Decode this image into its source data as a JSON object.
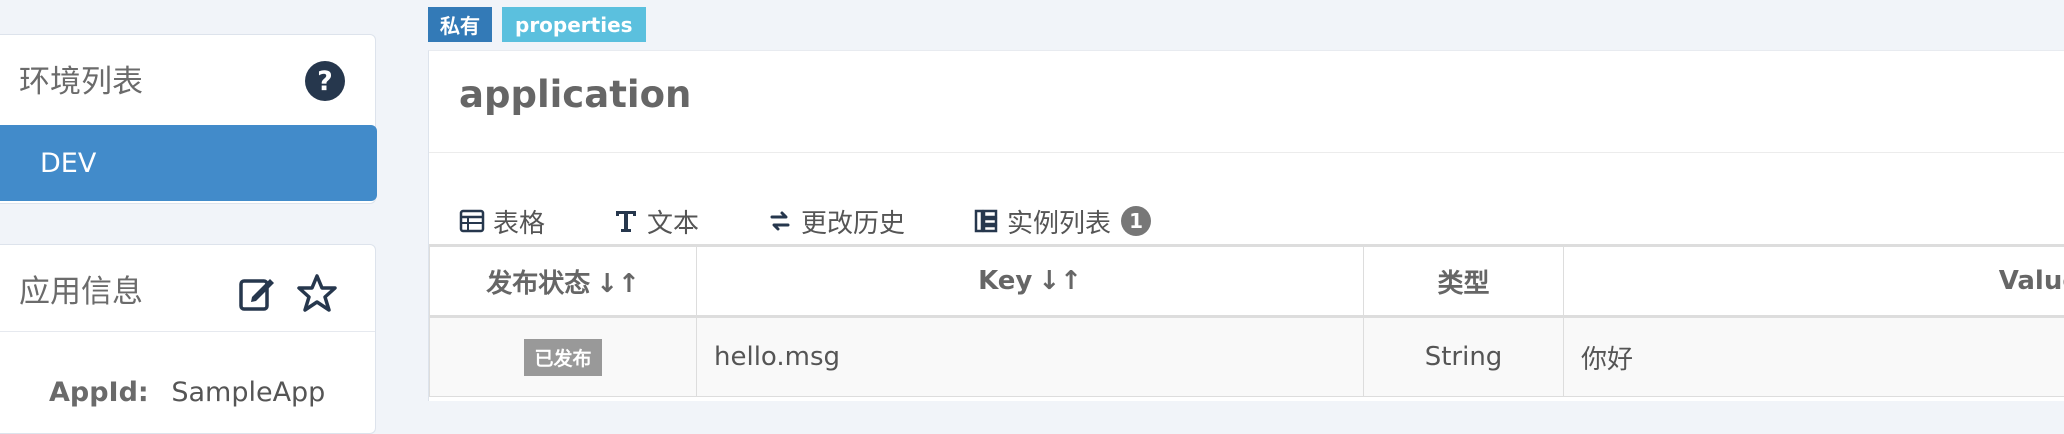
{
  "sidebar": {
    "env_panel": {
      "title": "环境列表",
      "help_icon": "question-circle-icon",
      "items": [
        {
          "label": "DEV",
          "active": true
        }
      ]
    },
    "app_panel": {
      "title": "应用信息",
      "edit_icon": "edit-icon",
      "star_icon": "star-icon",
      "appid_label": "AppId:",
      "appid_value": "SampleApp"
    }
  },
  "namespace": {
    "badges": {
      "private": "私有",
      "format": "properties"
    },
    "title": "application",
    "tabs": [
      {
        "label": "表格",
        "icon": "table-icon",
        "active": true
      },
      {
        "label": "文本",
        "icon": "text-icon",
        "active": false
      },
      {
        "label": "更改历史",
        "icon": "history-icon",
        "active": false
      },
      {
        "label": "实例列表",
        "icon": "instances-icon",
        "active": false,
        "count": "1"
      }
    ],
    "table": {
      "headers": {
        "status": "发布状态",
        "key": "Key",
        "type": "类型",
        "value": "Value"
      },
      "rows": [
        {
          "status": "已发布",
          "key": "hello.msg",
          "type": "String",
          "value": "你好"
        }
      ]
    }
  },
  "colors": {
    "accent": "#428bca",
    "badge_private": "#337ab7",
    "badge_format": "#5bc0de",
    "tab_underline": "#1e6b8c",
    "status_label": "#999999"
  }
}
